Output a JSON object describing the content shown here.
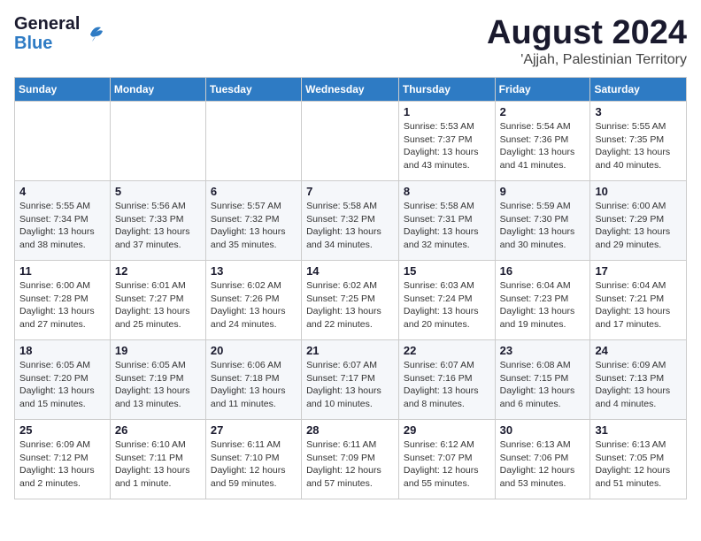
{
  "header": {
    "logo_line1": "General",
    "logo_line2": "Blue",
    "month_year": "August 2024",
    "location": "'Ajjah, Palestinian Territory"
  },
  "weekdays": [
    "Sunday",
    "Monday",
    "Tuesday",
    "Wednesday",
    "Thursday",
    "Friday",
    "Saturday"
  ],
  "weeks": [
    [
      {
        "day": "",
        "detail": ""
      },
      {
        "day": "",
        "detail": ""
      },
      {
        "day": "",
        "detail": ""
      },
      {
        "day": "",
        "detail": ""
      },
      {
        "day": "1",
        "detail": "Sunrise: 5:53 AM\nSunset: 7:37 PM\nDaylight: 13 hours\nand 43 minutes."
      },
      {
        "day": "2",
        "detail": "Sunrise: 5:54 AM\nSunset: 7:36 PM\nDaylight: 13 hours\nand 41 minutes."
      },
      {
        "day": "3",
        "detail": "Sunrise: 5:55 AM\nSunset: 7:35 PM\nDaylight: 13 hours\nand 40 minutes."
      }
    ],
    [
      {
        "day": "4",
        "detail": "Sunrise: 5:55 AM\nSunset: 7:34 PM\nDaylight: 13 hours\nand 38 minutes."
      },
      {
        "day": "5",
        "detail": "Sunrise: 5:56 AM\nSunset: 7:33 PM\nDaylight: 13 hours\nand 37 minutes."
      },
      {
        "day": "6",
        "detail": "Sunrise: 5:57 AM\nSunset: 7:32 PM\nDaylight: 13 hours\nand 35 minutes."
      },
      {
        "day": "7",
        "detail": "Sunrise: 5:58 AM\nSunset: 7:32 PM\nDaylight: 13 hours\nand 34 minutes."
      },
      {
        "day": "8",
        "detail": "Sunrise: 5:58 AM\nSunset: 7:31 PM\nDaylight: 13 hours\nand 32 minutes."
      },
      {
        "day": "9",
        "detail": "Sunrise: 5:59 AM\nSunset: 7:30 PM\nDaylight: 13 hours\nand 30 minutes."
      },
      {
        "day": "10",
        "detail": "Sunrise: 6:00 AM\nSunset: 7:29 PM\nDaylight: 13 hours\nand 29 minutes."
      }
    ],
    [
      {
        "day": "11",
        "detail": "Sunrise: 6:00 AM\nSunset: 7:28 PM\nDaylight: 13 hours\nand 27 minutes."
      },
      {
        "day": "12",
        "detail": "Sunrise: 6:01 AM\nSunset: 7:27 PM\nDaylight: 13 hours\nand 25 minutes."
      },
      {
        "day": "13",
        "detail": "Sunrise: 6:02 AM\nSunset: 7:26 PM\nDaylight: 13 hours\nand 24 minutes."
      },
      {
        "day": "14",
        "detail": "Sunrise: 6:02 AM\nSunset: 7:25 PM\nDaylight: 13 hours\nand 22 minutes."
      },
      {
        "day": "15",
        "detail": "Sunrise: 6:03 AM\nSunset: 7:24 PM\nDaylight: 13 hours\nand 20 minutes."
      },
      {
        "day": "16",
        "detail": "Sunrise: 6:04 AM\nSunset: 7:23 PM\nDaylight: 13 hours\nand 19 minutes."
      },
      {
        "day": "17",
        "detail": "Sunrise: 6:04 AM\nSunset: 7:21 PM\nDaylight: 13 hours\nand 17 minutes."
      }
    ],
    [
      {
        "day": "18",
        "detail": "Sunrise: 6:05 AM\nSunset: 7:20 PM\nDaylight: 13 hours\nand 15 minutes."
      },
      {
        "day": "19",
        "detail": "Sunrise: 6:05 AM\nSunset: 7:19 PM\nDaylight: 13 hours\nand 13 minutes."
      },
      {
        "day": "20",
        "detail": "Sunrise: 6:06 AM\nSunset: 7:18 PM\nDaylight: 13 hours\nand 11 minutes."
      },
      {
        "day": "21",
        "detail": "Sunrise: 6:07 AM\nSunset: 7:17 PM\nDaylight: 13 hours\nand 10 minutes."
      },
      {
        "day": "22",
        "detail": "Sunrise: 6:07 AM\nSunset: 7:16 PM\nDaylight: 13 hours\nand 8 minutes."
      },
      {
        "day": "23",
        "detail": "Sunrise: 6:08 AM\nSunset: 7:15 PM\nDaylight: 13 hours\nand 6 minutes."
      },
      {
        "day": "24",
        "detail": "Sunrise: 6:09 AM\nSunset: 7:13 PM\nDaylight: 13 hours\nand 4 minutes."
      }
    ],
    [
      {
        "day": "25",
        "detail": "Sunrise: 6:09 AM\nSunset: 7:12 PM\nDaylight: 13 hours\nand 2 minutes."
      },
      {
        "day": "26",
        "detail": "Sunrise: 6:10 AM\nSunset: 7:11 PM\nDaylight: 13 hours\nand 1 minute."
      },
      {
        "day": "27",
        "detail": "Sunrise: 6:11 AM\nSunset: 7:10 PM\nDaylight: 12 hours\nand 59 minutes."
      },
      {
        "day": "28",
        "detail": "Sunrise: 6:11 AM\nSunset: 7:09 PM\nDaylight: 12 hours\nand 57 minutes."
      },
      {
        "day": "29",
        "detail": "Sunrise: 6:12 AM\nSunset: 7:07 PM\nDaylight: 12 hours\nand 55 minutes."
      },
      {
        "day": "30",
        "detail": "Sunrise: 6:13 AM\nSunset: 7:06 PM\nDaylight: 12 hours\nand 53 minutes."
      },
      {
        "day": "31",
        "detail": "Sunrise: 6:13 AM\nSunset: 7:05 PM\nDaylight: 12 hours\nand 51 minutes."
      }
    ]
  ]
}
